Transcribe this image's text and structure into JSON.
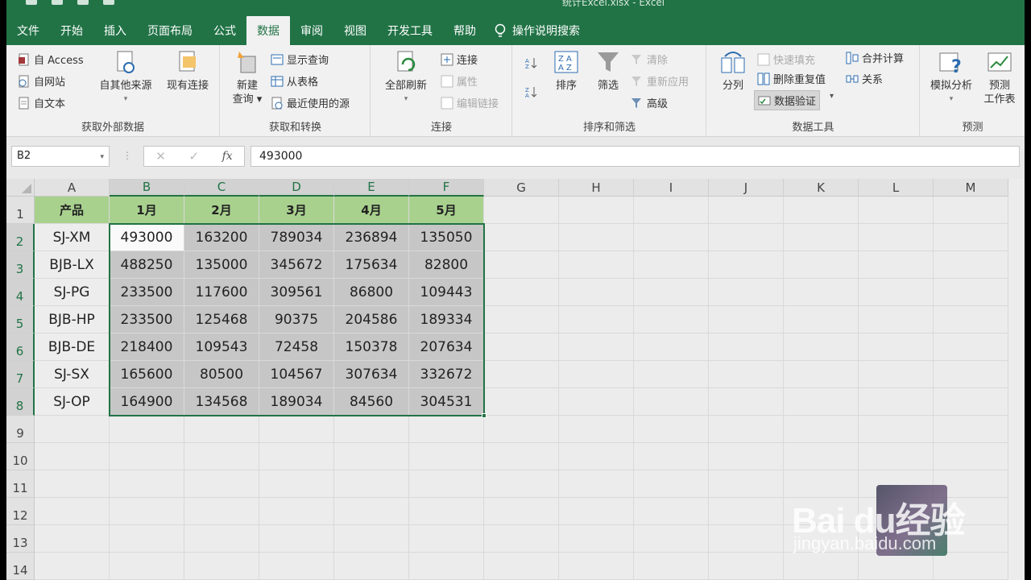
{
  "window": {
    "title": "统计Excel.xlsx - Excel",
    "quick_access": [
      "save-icon",
      "undo-icon",
      "redo-icon",
      "print-preview-icon"
    ]
  },
  "tabs": [
    "文件",
    "开始",
    "插入",
    "页面布局",
    "公式",
    "数据",
    "审阅",
    "视图",
    "开发工具",
    "帮助"
  ],
  "active_tab": "数据",
  "tell_me": "操作说明搜索",
  "ribbon": {
    "get_external": {
      "label": "获取外部数据",
      "access": "自 Access",
      "web": "自网站",
      "text": "自文本",
      "other_sources": "自其他来源",
      "existing": "现有连接"
    },
    "get_transform": {
      "label": "获取和转换",
      "new_query_1": "新建",
      "new_query_2": "查询",
      "show_queries": "显示查询",
      "from_table": "从表格",
      "recent_sources": "最近使用的源"
    },
    "connections": {
      "label": "连接",
      "refresh_all": "全部刷新",
      "connections": "连接",
      "properties": "属性",
      "edit_links": "编辑链接"
    },
    "sort_filter": {
      "label": "排序和筛选",
      "sort": "排序",
      "filter": "筛选",
      "clear": "清除",
      "reapply": "重新应用",
      "advanced": "高级"
    },
    "data_tools": {
      "label": "数据工具",
      "text_to_columns": "分列",
      "flash_fill": "快速填充",
      "remove_duplicates": "删除重复值",
      "data_validation": "数据验证",
      "consolidate": "合并计算",
      "relationships": "关系"
    },
    "forecast": {
      "label": "预测",
      "what_if": "模拟分析",
      "forecast_sheet_1": "预测",
      "forecast_sheet_2": "工作表"
    }
  },
  "formula_bar": {
    "name_box": "B2",
    "fx": "fx",
    "value": "493000"
  },
  "sheet": {
    "columns": [
      "A",
      "B",
      "C",
      "D",
      "E",
      "F",
      "G",
      "H",
      "I",
      "J",
      "K",
      "L",
      "M"
    ],
    "rows": [
      "1",
      "2",
      "3",
      "4",
      "5",
      "6",
      "7",
      "8",
      "9",
      "10",
      "11",
      "12",
      "13",
      "14"
    ],
    "header": [
      "产品",
      "1月",
      "2月",
      "3月",
      "4月",
      "5月"
    ],
    "data": [
      [
        "SJ-XM",
        "493000",
        "163200",
        "789034",
        "236894",
        "135050"
      ],
      [
        "BJB-LX",
        "488250",
        "135000",
        "345672",
        "175634",
        "82800"
      ],
      [
        "SJ-PG",
        "233500",
        "117600",
        "309561",
        "86800",
        "109443"
      ],
      [
        "BJB-HP",
        "233500",
        "125468",
        "90375",
        "204586",
        "189334"
      ],
      [
        "BJB-DE",
        "218400",
        "109543",
        "72458",
        "150378",
        "207634"
      ],
      [
        "SJ-SX",
        "165600",
        "80500",
        "104567",
        "307634",
        "332672"
      ],
      [
        "SJ-OP",
        "164900",
        "134568",
        "189034",
        "84560",
        "304531"
      ]
    ]
  },
  "watermark": {
    "logo": "Bai du经验",
    "url": "jingyan.baidu.com"
  },
  "colors": {
    "excel_green": "#217346",
    "header_fill": "#a9d18e"
  }
}
